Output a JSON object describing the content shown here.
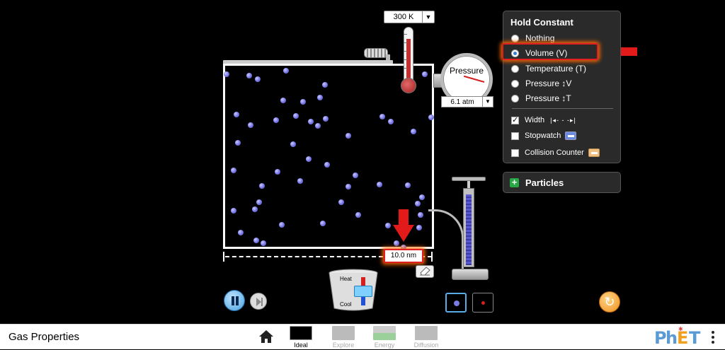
{
  "app": {
    "title": "Gas Properties"
  },
  "thermometer": {
    "value": "300 K"
  },
  "pressure_gauge": {
    "label": "Pressure",
    "value": "6.1 atm"
  },
  "width_ruler": {
    "value": "10.0 nm"
  },
  "bucket": {
    "heat_label": "Heat",
    "cool_label": "Cool"
  },
  "hold_constant": {
    "title": "Hold Constant",
    "options": [
      {
        "label": "Nothing",
        "selected": false
      },
      {
        "label": "Volume (V)",
        "selected": true
      },
      {
        "label": "Temperature (T)",
        "selected": false
      },
      {
        "label": "Pressure ↕V",
        "selected": false
      },
      {
        "label": "Pressure ↕T",
        "selected": false
      }
    ],
    "checkboxes": [
      {
        "label": "Width",
        "checked": true
      },
      {
        "label": "Stopwatch",
        "checked": false
      },
      {
        "label": "Collision Counter",
        "checked": false
      }
    ]
  },
  "particles_panel": {
    "title": "Particles"
  },
  "navbar": {
    "screens": [
      {
        "label": "Ideal",
        "active": true
      },
      {
        "label": "Explore",
        "active": false
      },
      {
        "label": "Energy",
        "active": false
      },
      {
        "label": "Diffusion",
        "active": false
      }
    ]
  },
  "colors": {
    "highlight": "#e02020",
    "particle": "#7b7be8",
    "accent": "#3a7bd5"
  }
}
